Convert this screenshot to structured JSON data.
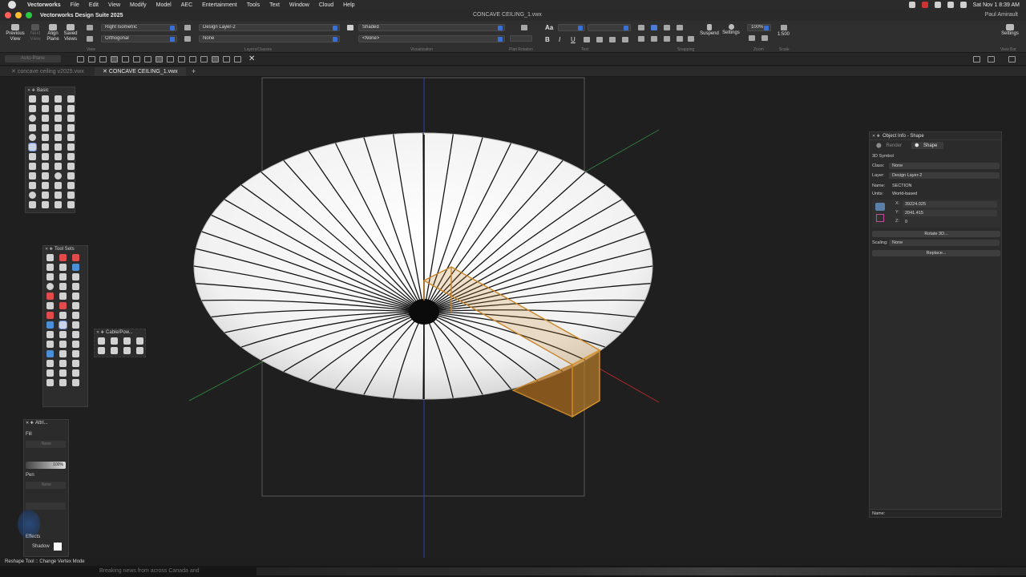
{
  "menubar": {
    "app": "Vectorworks",
    "items": [
      "File",
      "Edit",
      "View",
      "Modify",
      "Model",
      "AEC",
      "Entertainment",
      "Tools",
      "Text",
      "Window",
      "Cloud",
      "Help"
    ],
    "clock": "Sat Nov 1  8:39 AM"
  },
  "titlebar": {
    "app_title": "Vectorworks Design Suite 2025",
    "document": "CONCAVE CEILING_1.vwx",
    "user": "Paul Amirault"
  },
  "toolbar": {
    "previous_view": "Previous View",
    "next_view": "Next View",
    "align_plane": "Align Plane",
    "saved_views": "Saved Views",
    "view_combo": "Right Isometric",
    "projection_combo": "Orthogonal",
    "layer_combo": "Design Layer-2",
    "class_combo": "None",
    "render_combo": "Shaded",
    "render_sub_combo": "<None>",
    "suspend": "Suspend",
    "settings": "Settings",
    "zoom": "100%",
    "scale": "1:500",
    "settings_right": "Settings",
    "group_view": "View",
    "group_layers": "Layers/Classes",
    "group_visualization": "Visualization",
    "group_plan_rotation": "Plan Rotation",
    "group_text": "Text",
    "group_snapping": "Snapping",
    "group_zoom": "Zoom",
    "group_scale": "Scale",
    "group_viewbar": "View Bar",
    "font_size_icon": "Aa"
  },
  "modebar": {
    "auto_plane": "Auto-Plane"
  },
  "tabs": [
    {
      "label": "concave ceiling v2025.vwx",
      "active": false
    },
    {
      "label": "CONCAVE CEILING_1.vwx",
      "active": true
    }
  ],
  "palettes": {
    "basic": "Basic",
    "tool_sets": "Tool Sets",
    "cable": "Cable/Pow...",
    "attributes": "Attri...",
    "fill": "Fill",
    "fill_value": "None",
    "opacity": "100%",
    "pen": "Pen",
    "pen_value": "None",
    "effects": "Effects",
    "shadow": "Shadow"
  },
  "object_info": {
    "title": "Object Info - Shape",
    "tab_render": "Render",
    "tab_shape": "Shape",
    "type": "3D Symbol",
    "class_label": "Class:",
    "class_value": "None",
    "layer_label": "Layer:",
    "layer_value": "Design Layer-2",
    "name_label": "Name:",
    "name_value": "SECTION",
    "units_label": "Units:",
    "units_value": "World-based",
    "x_label": "X:",
    "x_value": "39224.025",
    "y_label": "Y:",
    "y_value": "2041.415",
    "z_label": "Z:",
    "z_value": "0",
    "rotate_btn": "Rotate 3D...",
    "scaling_label": "Scaling:",
    "scaling_value": "None",
    "replace_btn": "Replace...",
    "footer_name": "Name:"
  },
  "status": {
    "tool": "Reshape Tool :: Change Vertex Mode",
    "news": "Breaking news from across Canada and"
  },
  "scene": {
    "ray_count": 48,
    "ceiling_fill": "#ececec",
    "section_color": "#c8862a",
    "axis_x_color": "#d03030",
    "axis_y_color": "#3aa24a",
    "axis_z_color": "#3a4fd8"
  }
}
